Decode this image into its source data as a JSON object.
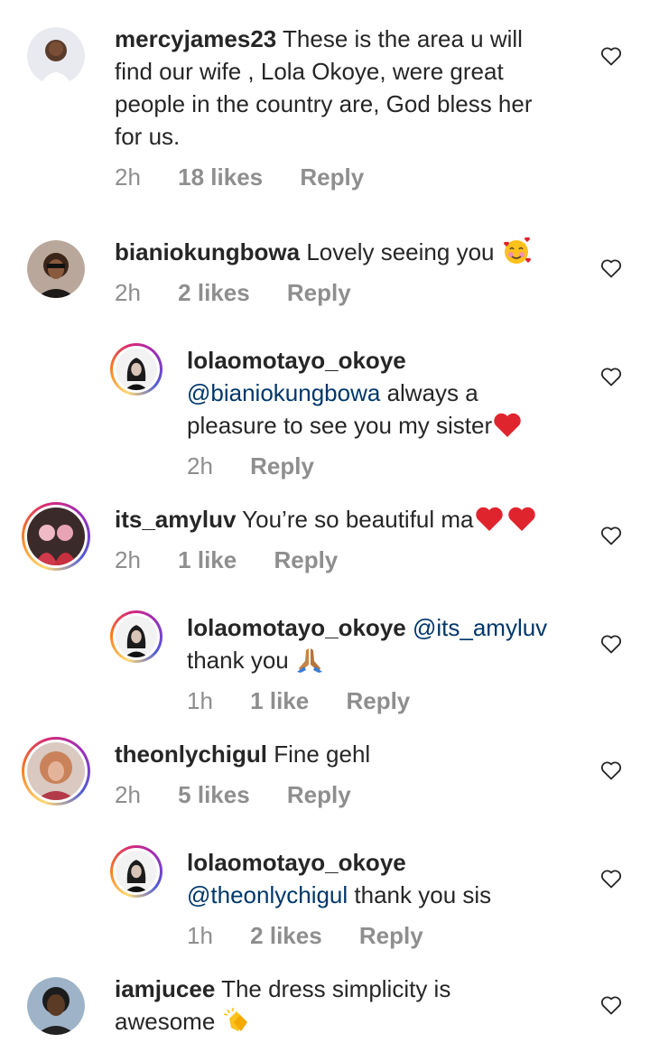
{
  "comments": [
    {
      "username": "mercyjames23",
      "text": "These is the area u will find our wife , Lola Okoye, were great people in the country are, God bless her for us.",
      "time": "2h",
      "likes": "18 likes",
      "reply": "Reply",
      "avatar_icon": "user-avatar"
    },
    {
      "username": "bianiokungbowa",
      "text": "Lovely seeing you",
      "emoji_icon": "smiling-face-with-hearts-emoji",
      "time": "2h",
      "likes": "2 likes",
      "reply": "Reply"
    },
    {
      "username": "lolaomotayo_okoye",
      "mention": "@bianiokungbowa",
      "text": "always a pleasure to see you my sister",
      "emoji_icon": "red-heart-emoji",
      "time": "2h",
      "reply": "Reply"
    },
    {
      "username": "its_amyluv",
      "text": "You’re so beautiful ma",
      "emoji_icon": "two-red-hearts-emoji",
      "time": "2h",
      "likes": "1 like",
      "reply": "Reply"
    },
    {
      "username": "lolaomotayo_okoye",
      "mention": "@its_amyluv",
      "text": "thank you",
      "emoji_icon": "folded-hands-emoji",
      "time": "1h",
      "likes": "1 like",
      "reply": "Reply"
    },
    {
      "username": "theonlychigul",
      "text": "Fine gehl",
      "time": "2h",
      "likes": "5 likes",
      "reply": "Reply"
    },
    {
      "username": "lolaomotayo_okoye",
      "mention": "@theonlychigul",
      "text": "thank you sis",
      "time": "1h",
      "likes": "2 likes",
      "reply": "Reply"
    },
    {
      "username": "iamjucee",
      "text": "The dress simplicity is awesome",
      "emoji_icon": "clapping-hands-emoji"
    }
  ],
  "colors": {
    "text": "#262626",
    "meta": "#8e8e8e",
    "mention": "#00376b",
    "heart_emoji": "#e0242e"
  },
  "icons": {
    "like": "heart-outline-icon"
  }
}
